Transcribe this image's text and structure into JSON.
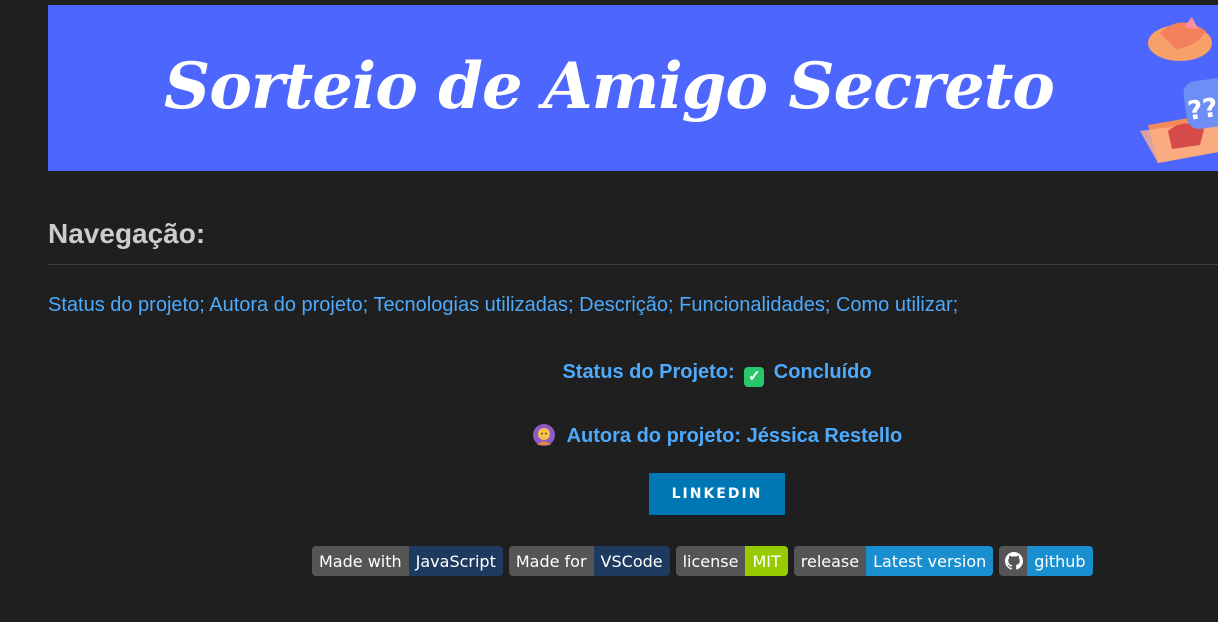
{
  "banner": {
    "title": "Sorteio de Amigo Secreto",
    "art_icon": "gift-box-question-icon",
    "background": "#4d67fe",
    "art_text": "???"
  },
  "navigation": {
    "heading": "Navegação:",
    "links": [
      "Status do projeto;",
      "Autora do projeto;",
      "Tecnologias utilizadas;",
      "Descrição;",
      "Funcionalidades;",
      "Como utilizar;"
    ]
  },
  "status": {
    "label": "Status do Projeto:",
    "icon": "check-mark-icon",
    "value": "Concluído"
  },
  "author": {
    "icon": "woman-icon",
    "label": "Autora do projeto: Jéssica Restello"
  },
  "linkedin": {
    "label": "LINKEDIN",
    "color": "#0077b5"
  },
  "badges": [
    {
      "left": "Made with",
      "right": "JavaScript"
    },
    {
      "left": "Made for",
      "right": "VSCode"
    },
    {
      "left": "license",
      "right": "MIT"
    },
    {
      "left": "release",
      "right": "Latest version"
    },
    {
      "left_icon": "github-icon",
      "right": "github"
    }
  ],
  "colors": {
    "link": "#4daafc",
    "background": "#1f1f1f"
  }
}
